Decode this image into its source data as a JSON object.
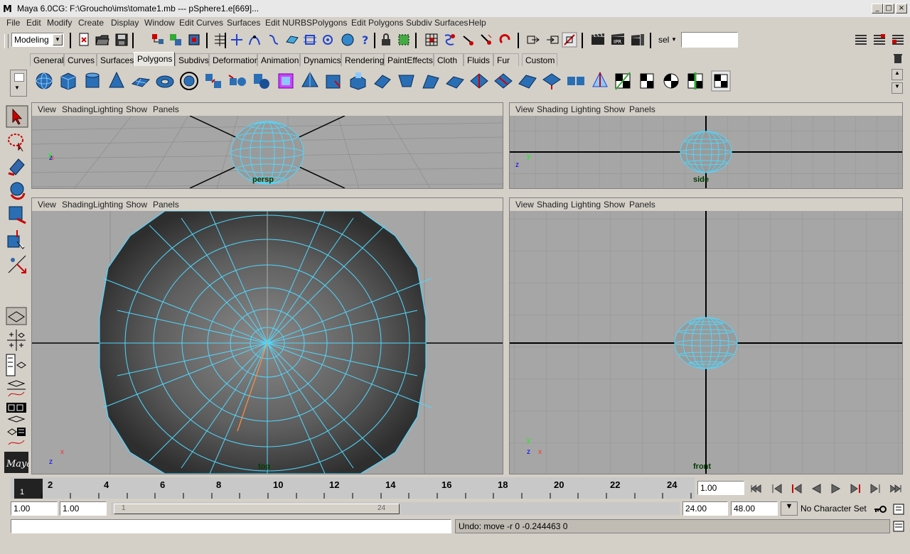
{
  "window": {
    "title": "Maya 6.0CG: F:\\Groucho\\ims\\tomate1.mb  ---   pSphere1.e[669]...",
    "buttons": {
      "minimize": "_",
      "maximize": "□",
      "close": "×"
    }
  },
  "menubar": [
    "File",
    "Edit",
    "Modify",
    "Create",
    "Display",
    "Window",
    "Edit Curves",
    "Surfaces",
    "Edit NURBS",
    "Polygons",
    "Edit Polygons",
    "Subdiv Surfaces",
    "Help"
  ],
  "statusline": {
    "mode": "Modeling",
    "sel_label": "sel",
    "sel_value": ""
  },
  "shelf_tabs": [
    "General",
    "Curves",
    "Surfaces",
    "Polygons",
    "Subdivs",
    "Deformation",
    "Animation",
    "Dynamics",
    "Rendering",
    "PaintEffects",
    "Cloth",
    "Fluids",
    "Fur",
    "Custom"
  ],
  "active_shelf_tab": "Polygons",
  "viewport_menu": [
    "View",
    "Shading",
    "Lighting",
    "Show",
    "Panels"
  ],
  "viewports": {
    "persp": {
      "label": "persp"
    },
    "side": {
      "label": "side"
    },
    "top": {
      "label": "top"
    },
    "front": {
      "label": "front"
    }
  },
  "axes": {
    "x": "x",
    "y": "y",
    "z": "z"
  },
  "timeline": {
    "current": "1",
    "ticks": [
      "2",
      "4",
      "6",
      "8",
      "10",
      "12",
      "14",
      "16",
      "18",
      "20",
      "22",
      "24"
    ],
    "current_time": "1.00"
  },
  "range": {
    "start": "1.00",
    "playback_start": "1.00",
    "slider_start": "1",
    "slider_end": "24",
    "playback_end": "24.00",
    "end": "48.00",
    "character_set": "No Character Set"
  },
  "commandline": {
    "input": "",
    "feedback": "Undo: move -r 0 -0.244463 0"
  },
  "colors": {
    "wire": "#4fd8ff",
    "background": "#d4d0c8",
    "viewport": "#a0a0a0"
  }
}
